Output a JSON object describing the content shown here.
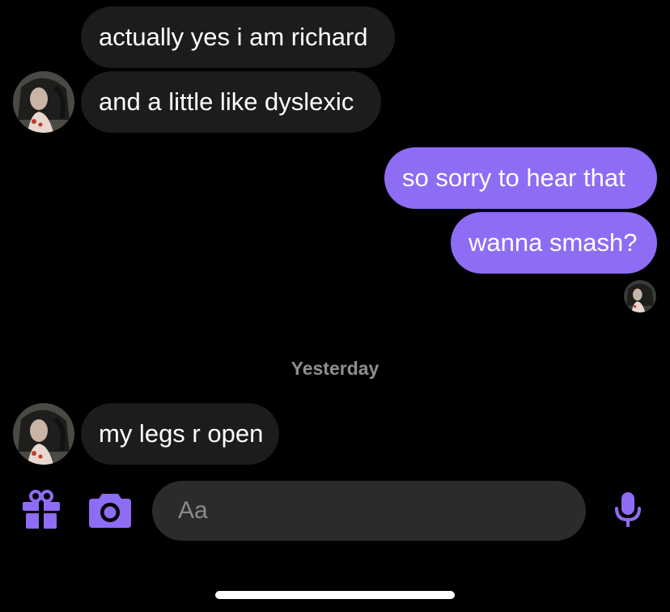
{
  "messages": [
    {
      "text": "actually yes i am richard",
      "sender": "other"
    },
    {
      "text": "and a little like dyslexic",
      "sender": "other"
    },
    {
      "text": "so sorry to hear that",
      "sender": "me"
    },
    {
      "text": "wanna smash?",
      "sender": "me"
    },
    {
      "text": "my legs r open",
      "sender": "other"
    }
  ],
  "date_separator": "Yesterday",
  "composer": {
    "placeholder": "Aa",
    "icons": [
      "gift-icon",
      "camera-icon",
      "microphone-icon"
    ]
  },
  "colors": {
    "background": "#000000",
    "incoming_bubble": "#1c1c1e",
    "outgoing_bubble": "#8e6cf4",
    "accent": "#8e6cf4",
    "input_background": "#2b2b2b",
    "timestamp": "#8e8e93"
  }
}
